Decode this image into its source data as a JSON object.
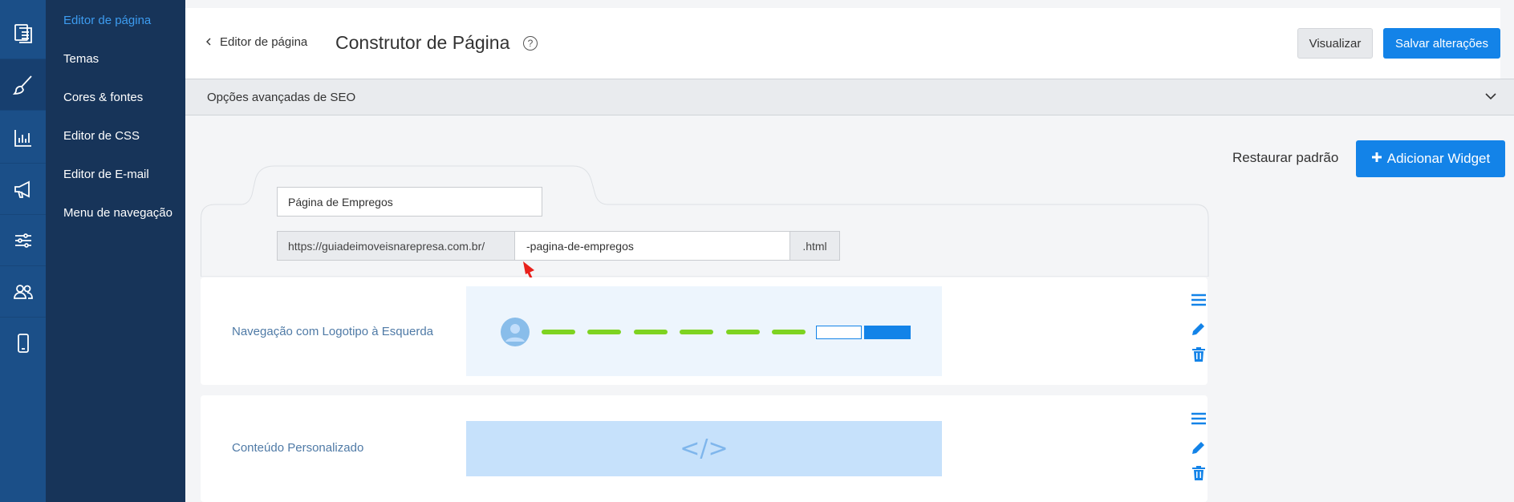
{
  "sidebar": {
    "rail_icons": [
      "pages-icon",
      "brush-icon",
      "stats-icon",
      "megaphone-icon",
      "sliders-icon",
      "users-icon",
      "mobile-icon"
    ],
    "menu": [
      {
        "label": "Editor de página",
        "active": true
      },
      {
        "label": "Temas",
        "active": false
      },
      {
        "label": "Cores & fontes",
        "active": false
      },
      {
        "label": "Editor de CSS",
        "active": false
      },
      {
        "label": "Editor de E-mail",
        "active": false
      },
      {
        "label": "Menu de navegação",
        "active": false
      }
    ]
  },
  "header": {
    "back_label": "Editor de página",
    "title": "Construtor de Página",
    "help_glyph": "?",
    "preview_label": "Visualizar",
    "save_label": "Salvar alterações"
  },
  "seo": {
    "label": "Opções avançadas de SEO"
  },
  "toolbar": {
    "restore_label": "Restaurar padrão",
    "add_widget_label": "Adicionar Widget"
  },
  "page_form": {
    "page_name": "Página de Empregos",
    "url_prefix": "https://guiadeimoveisnarepresa.com.br/",
    "slug": "-pagina-de-empregos",
    "url_suffix": ".html"
  },
  "widgets": [
    {
      "label": "Navegação com Logotipo à Esquerda"
    },
    {
      "label": "Conteúdo Personalizado",
      "preview_glyph": "</>"
    }
  ],
  "colors": {
    "accent": "#1383e8",
    "sidebar_rail": "#1b4f88",
    "sidebar_menu": "#173459",
    "nav_dash": "#7ed321",
    "annotation_arrow": "#e8201c"
  }
}
